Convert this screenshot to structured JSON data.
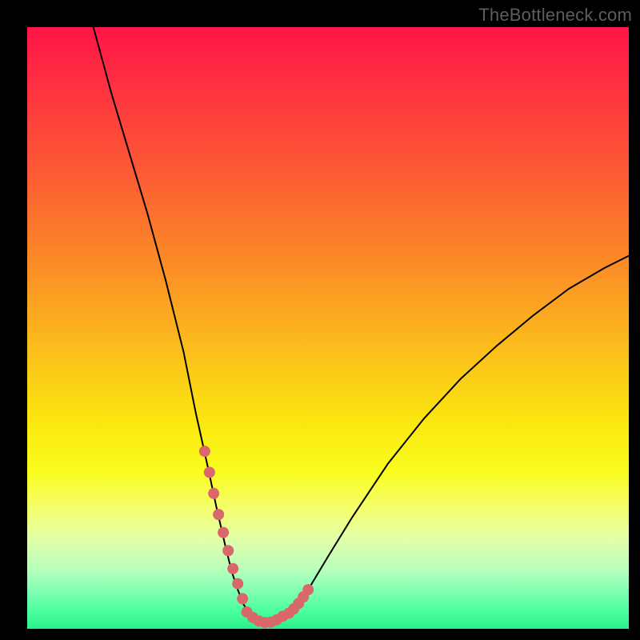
{
  "watermark": "TheBottleneck.com",
  "chart_data": {
    "type": "line",
    "title": "",
    "xlabel": "",
    "ylabel": "",
    "xlim": [
      0,
      100
    ],
    "ylim": [
      0,
      100
    ],
    "grid": false,
    "series": [
      {
        "name": "curve",
        "color": "#000000",
        "x": [
          11,
          14,
          17,
          20,
          23,
          26,
          28,
          30,
          31.5,
          33,
          34,
          35,
          36,
          37,
          38,
          39,
          40,
          41,
          42,
          43.5,
          45,
          47,
          50,
          54,
          60,
          66,
          72,
          78,
          84,
          90,
          96,
          100
        ],
        "y": [
          100,
          89,
          79,
          69,
          58,
          46,
          36,
          27,
          20,
          13.5,
          9.5,
          6.5,
          4,
          2.5,
          1.6,
          1.1,
          1.0,
          1.1,
          1.6,
          2.6,
          4.2,
          7.0,
          12.0,
          18.5,
          27.5,
          35.0,
          41.5,
          47.0,
          52.0,
          56.5,
          60.0,
          62.0
        ]
      },
      {
        "name": "highlight-left",
        "color": "#d9676b",
        "x": [
          29.5,
          30.3,
          31.0,
          31.8,
          32.6,
          33.4,
          34.2,
          35.0,
          35.8
        ],
        "y": [
          29.5,
          26.0,
          22.5,
          19.0,
          16.0,
          13.0,
          10.0,
          7.5,
          5.0
        ]
      },
      {
        "name": "highlight-right",
        "color": "#d9676b",
        "x": [
          43.5,
          44.3,
          45.1,
          45.9,
          46.7
        ],
        "y": [
          2.6,
          3.3,
          4.2,
          5.3,
          6.5
        ]
      },
      {
        "name": "highlight-bottom",
        "color": "#d9676b",
        "x": [
          36.5,
          37.5,
          38.5,
          39.5,
          40.5,
          41.5,
          42.5
        ],
        "y": [
          2.8,
          1.9,
          1.3,
          1.05,
          1.1,
          1.5,
          2.1
        ]
      }
    ]
  }
}
